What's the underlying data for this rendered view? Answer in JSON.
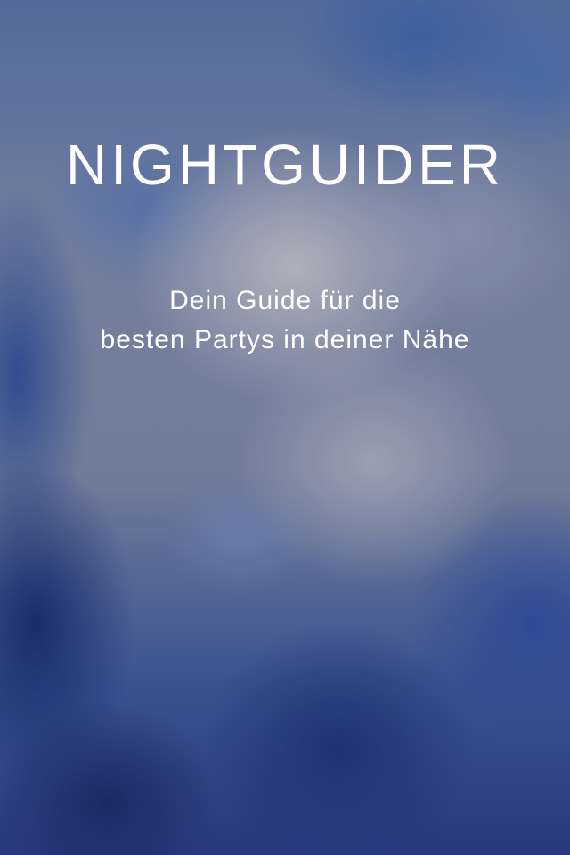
{
  "app": {
    "title": "NIGHTGUIDER",
    "tagline_line1": "Dein Guide für die",
    "tagline_line2": "besten Partys in deiner Nähe"
  },
  "colors": {
    "text": "#ffffff",
    "background_dominant": "#6f7f9e",
    "accent_blue": "#2a3a85"
  }
}
